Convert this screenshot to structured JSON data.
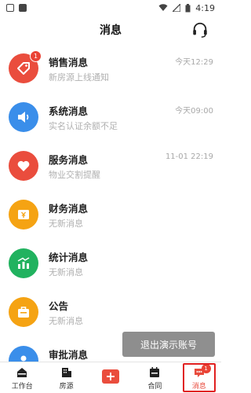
{
  "statusbar": {
    "time": "4:19"
  },
  "header": {
    "title": "消息"
  },
  "messages": [
    {
      "title": "销售消息",
      "subtitle": "新房源上线通知",
      "time": "今天12:29",
      "badge": "1",
      "color": "#ea4d3d",
      "icon": "tag-icon"
    },
    {
      "title": "系统消息",
      "subtitle": "实名认证余额不足",
      "time": "今天09:00",
      "badge": "",
      "color": "#3a8eea",
      "icon": "speaker-icon"
    },
    {
      "title": "服务消息",
      "subtitle": "物业交割提醒",
      "time": "11-01 22:19",
      "badge": "",
      "color": "#ea4d3d",
      "icon": "heart-icon"
    },
    {
      "title": "财务消息",
      "subtitle": "无新消息",
      "time": "",
      "badge": "",
      "color": "#f5a313",
      "icon": "finance-icon"
    },
    {
      "title": "统计消息",
      "subtitle": "无新消息",
      "time": "",
      "badge": "",
      "color": "#21b25f",
      "icon": "chart-icon"
    },
    {
      "title": "公告",
      "subtitle": "无新消息",
      "time": "",
      "badge": "",
      "color": "#f5a313",
      "icon": "briefcase-icon"
    },
    {
      "title": "审批消息",
      "subtitle": "",
      "time": "",
      "badge": "",
      "color": "#3a8eea",
      "icon": "approval-icon"
    }
  ],
  "toast": {
    "text": "退出演示账号"
  },
  "tabbar": {
    "items": [
      {
        "label": "工作台",
        "icon": "home-icon"
      },
      {
        "label": "房源",
        "icon": "building-icon"
      },
      {
        "label": "",
        "icon": "add-icon"
      },
      {
        "label": "合同",
        "icon": "contract-icon"
      },
      {
        "label": "消息",
        "icon": "message-icon",
        "badge": "1"
      }
    ]
  }
}
